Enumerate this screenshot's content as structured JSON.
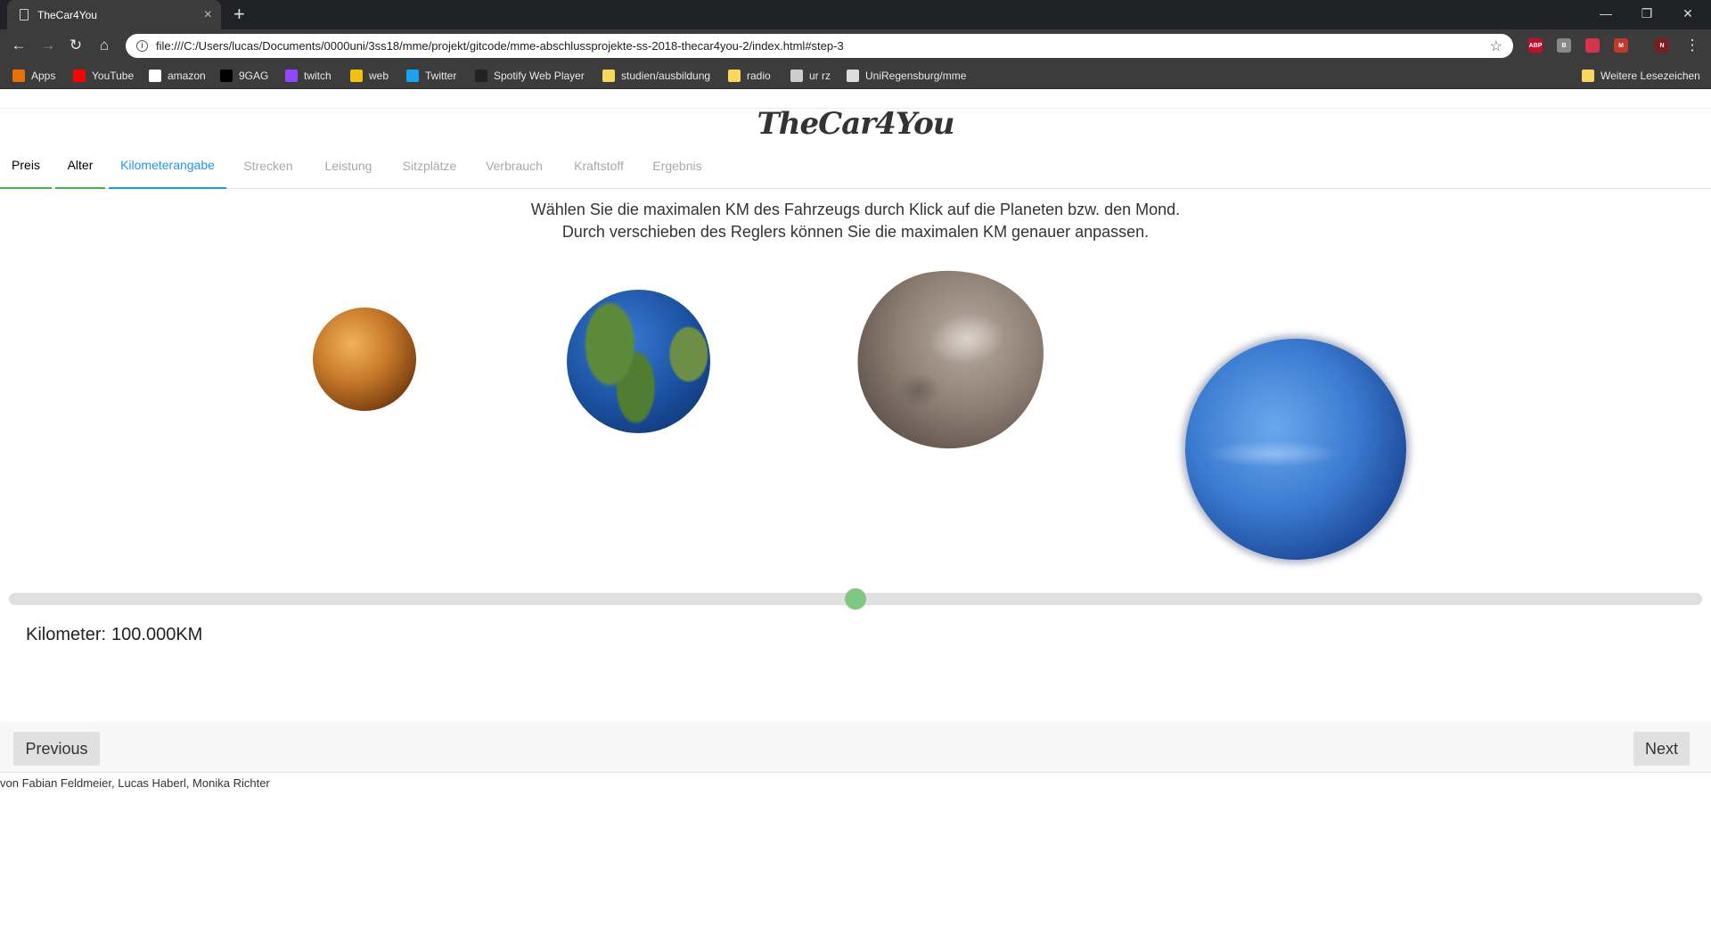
{
  "browser": {
    "tab_title": "TheCar4You",
    "url": "file:///C:/Users/lucas/Documents/0000uni/3ss18/mme/projekt/gitcode/mme-abschlussprojekte-ss-2018-thecar4you-2/index.html#step-3",
    "bookmarks": [
      {
        "label": "Apps",
        "icon": "apps-grid-icon",
        "color": "#e8710a"
      },
      {
        "label": "YouTube",
        "icon": "youtube-icon",
        "color": "#ff0000"
      },
      {
        "label": "amazon",
        "icon": "amazon-icon",
        "color": "#ffffff"
      },
      {
        "label": "9GAG",
        "icon": "9gag-icon",
        "color": "#000000"
      },
      {
        "label": "twitch",
        "icon": "twitch-icon",
        "color": "#9146ff"
      },
      {
        "label": "web",
        "icon": "web-icon",
        "color": "#f4c20d"
      },
      {
        "label": "Twitter",
        "icon": "twitter-icon",
        "color": "#1da1f2"
      },
      {
        "label": "Spotify Web Player",
        "icon": "spotify-icon",
        "color": "#222222"
      },
      {
        "label": "studien/ausbildung",
        "icon": "folder-icon",
        "color": "#f9d65c"
      },
      {
        "label": "radio",
        "icon": "folder-icon",
        "color": "#f9d65c"
      },
      {
        "label": "ur rz",
        "icon": "page-icon",
        "color": "#cccccc"
      },
      {
        "label": "UniRegensburg/mme",
        "icon": "github-icon",
        "color": "#dddddd"
      }
    ],
    "other_bookmarks": "Weitere Lesezeichen",
    "extensions": [
      {
        "label": "ABP",
        "color": "#c70d2c"
      },
      {
        "label": "B",
        "color": "#888888"
      },
      {
        "label": "",
        "color": "#d8334a"
      },
      {
        "label": "M",
        "color": "#c0392b"
      },
      {
        "label": "N",
        "color": "#7a1f1f"
      }
    ]
  },
  "app": {
    "logo": "TheCar4You",
    "steps": [
      {
        "label": "Preis",
        "state": "done"
      },
      {
        "label": "Alter",
        "state": "done"
      },
      {
        "label": "Kilometerangabe",
        "state": "active"
      },
      {
        "label": "Strecken",
        "state": "pending"
      },
      {
        "label": "Leistung",
        "state": "pending"
      },
      {
        "label": "Sitzplätze",
        "state": "pending"
      },
      {
        "label": "Verbrauch",
        "state": "pending"
      },
      {
        "label": "Kraftstoff",
        "state": "pending"
      },
      {
        "label": "Ergebnis",
        "state": "pending"
      }
    ],
    "instruction_line1": "Wählen Sie die maximalen KM des Fahrzeugs durch Klick auf die Planeten bzw. den Mond.",
    "instruction_line2": "Durch verschieben des Reglers können Sie die maximalen KM genauer anpassen.",
    "planets": [
      "venus",
      "earth",
      "moon",
      "neptune"
    ],
    "slider_fraction": 0.5,
    "km_label": "Kilometer:",
    "km_value": "100.000KM",
    "prev_label": "Previous",
    "next_label": "Next",
    "credits": "von Fabian Feldmeier, Lucas Haberl, Monika Richter",
    "colors": {
      "done": "#4caf50",
      "active": "#2196f3",
      "thumb": "#81c784"
    }
  }
}
